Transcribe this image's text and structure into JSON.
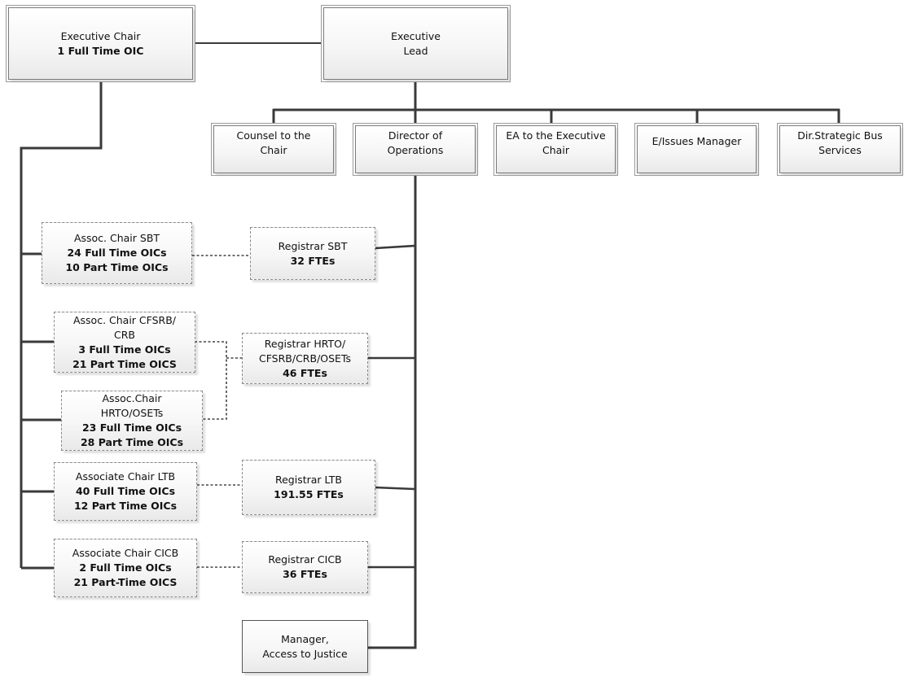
{
  "diagram": {
    "type": "org-chart",
    "colors": {
      "line": "#3a3a3a",
      "box_border": "#7a7a7a",
      "dashed_border": "#8a8a8a",
      "box_fill_top": "#ffffff",
      "box_fill_bottom": "#e9e9e9"
    },
    "nodes": {
      "executive_chair": {
        "lines": [
          "Executive Chair"
        ],
        "bold_lines": [
          "1 Full Time OIC"
        ]
      },
      "executive_lead": {
        "lines": [
          "Executive",
          "Lead"
        ],
        "bold_lines": []
      },
      "counsel": {
        "lines": [
          "Counsel to the",
          "Chair"
        ],
        "bold_lines": []
      },
      "director_operations": {
        "lines": [
          "Director of",
          "Operations"
        ],
        "bold_lines": []
      },
      "ea_exec_chair": {
        "lines": [
          "EA to the Executive",
          "Chair"
        ],
        "bold_lines": []
      },
      "issues_manager": {
        "lines": [
          "E/Issues Manager"
        ],
        "bold_lines": []
      },
      "dir_strategic": {
        "lines": [
          "Dir.Strategic Bus",
          "Services"
        ],
        "bold_lines": []
      },
      "assoc_sbt": {
        "lines": [
          "Assoc. Chair SBT"
        ],
        "bold_lines": [
          "24 Full Time OICs",
          "10 Part Time OICs"
        ]
      },
      "registrar_sbt": {
        "lines": [
          "Registrar SBT"
        ],
        "bold_lines": [
          "32 FTEs"
        ]
      },
      "assoc_cfsrb": {
        "lines": [
          "Assoc. Chair CFSRB/",
          "CRB"
        ],
        "bold_lines": [
          "3 Full Time OICs",
          "21 Part Time OICS"
        ]
      },
      "registrar_hrto": {
        "lines": [
          "Registrar HRTO/",
          "CFSRB/CRB/OSETs"
        ],
        "bold_lines": [
          "46 FTEs"
        ]
      },
      "assoc_hrto": {
        "lines": [
          "Assoc.Chair",
          "HRTO/OSETs"
        ],
        "bold_lines": [
          "23 Full Time OICs",
          "28 Part Time OICs"
        ]
      },
      "assoc_ltb": {
        "lines": [
          "Associate Chair LTB"
        ],
        "bold_lines": [
          "40 Full Time OICs",
          "12 Part Time OICs"
        ]
      },
      "registrar_ltb": {
        "lines": [
          "Registrar LTB"
        ],
        "bold_lines": [
          "191.55 FTEs"
        ]
      },
      "assoc_cicb": {
        "lines": [
          "Associate Chair CICB"
        ],
        "bold_lines": [
          "2 Full Time OICs",
          "21 Part-Time OICS"
        ]
      },
      "registrar_cicb": {
        "lines": [
          "Registrar CICB"
        ],
        "bold_lines": [
          "36 FTEs"
        ]
      },
      "manager_access": {
        "lines": [
          "Manager,",
          "Access to Justice"
        ],
        "bold_lines": []
      }
    },
    "edges": [
      {
        "from": "executive_chair",
        "to": "executive_lead",
        "style": "solid"
      },
      {
        "from": "executive_lead",
        "to": "counsel",
        "style": "solid"
      },
      {
        "from": "executive_lead",
        "to": "director_operations",
        "style": "solid"
      },
      {
        "from": "executive_lead",
        "to": "ea_exec_chair",
        "style": "solid"
      },
      {
        "from": "executive_lead",
        "to": "issues_manager",
        "style": "solid"
      },
      {
        "from": "executive_lead",
        "to": "dir_strategic",
        "style": "solid"
      },
      {
        "from": "executive_chair",
        "to": "assoc_sbt",
        "style": "solid"
      },
      {
        "from": "executive_chair",
        "to": "assoc_cfsrb",
        "style": "solid"
      },
      {
        "from": "executive_chair",
        "to": "assoc_hrto",
        "style": "solid"
      },
      {
        "from": "executive_chair",
        "to": "assoc_ltb",
        "style": "solid"
      },
      {
        "from": "executive_chair",
        "to": "assoc_cicb",
        "style": "solid"
      },
      {
        "from": "director_operations",
        "to": "registrar_sbt",
        "style": "solid"
      },
      {
        "from": "director_operations",
        "to": "registrar_hrto",
        "style": "solid"
      },
      {
        "from": "director_operations",
        "to": "registrar_ltb",
        "style": "solid"
      },
      {
        "from": "director_operations",
        "to": "registrar_cicb",
        "style": "solid"
      },
      {
        "from": "director_operations",
        "to": "manager_access",
        "style": "solid"
      },
      {
        "from": "assoc_sbt",
        "to": "registrar_sbt",
        "style": "dotted"
      },
      {
        "from": "assoc_cfsrb",
        "to": "registrar_hrto",
        "style": "dotted"
      },
      {
        "from": "assoc_hrto",
        "to": "registrar_hrto",
        "style": "dotted"
      },
      {
        "from": "assoc_ltb",
        "to": "registrar_ltb",
        "style": "dotted"
      },
      {
        "from": "assoc_cicb",
        "to": "registrar_cicb",
        "style": "dotted"
      }
    ]
  }
}
